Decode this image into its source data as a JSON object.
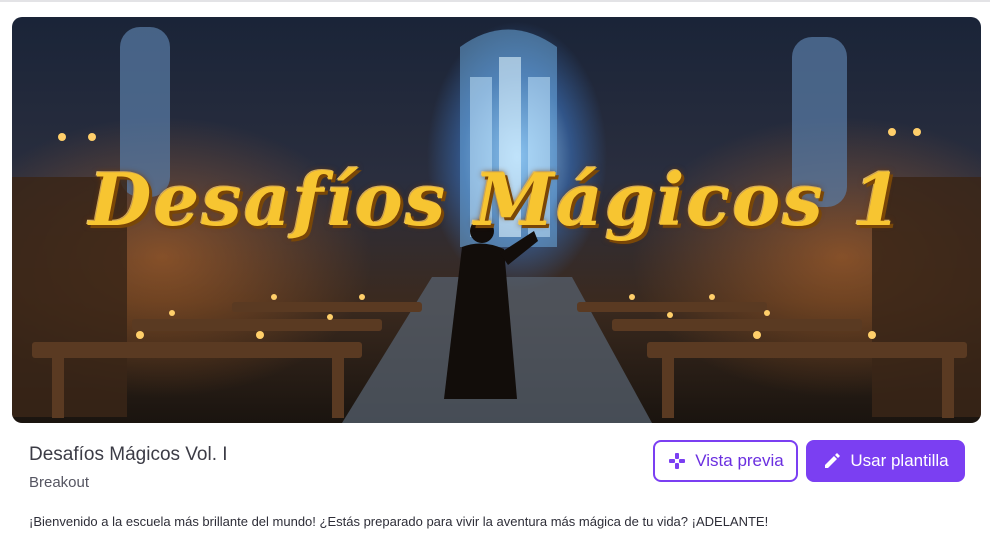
{
  "hero": {
    "title": "Desafíos Mágicos 1"
  },
  "template": {
    "title": "Desafíos Mágicos Vol. I",
    "type": "Breakout",
    "description": "¡Bienvenido a la escuela más brillante del mundo! ¿Estás preparado para vivir la aventura más mágica de tu vida? ¡ADELANTE!"
  },
  "actions": {
    "preview_label": "Vista previa",
    "preview_icon": "gamepad-icon",
    "use_label": "Usar plantilla",
    "use_icon": "pencil-icon"
  },
  "colors": {
    "accent": "#7b3ff2",
    "title_gold": "#f7c531"
  }
}
